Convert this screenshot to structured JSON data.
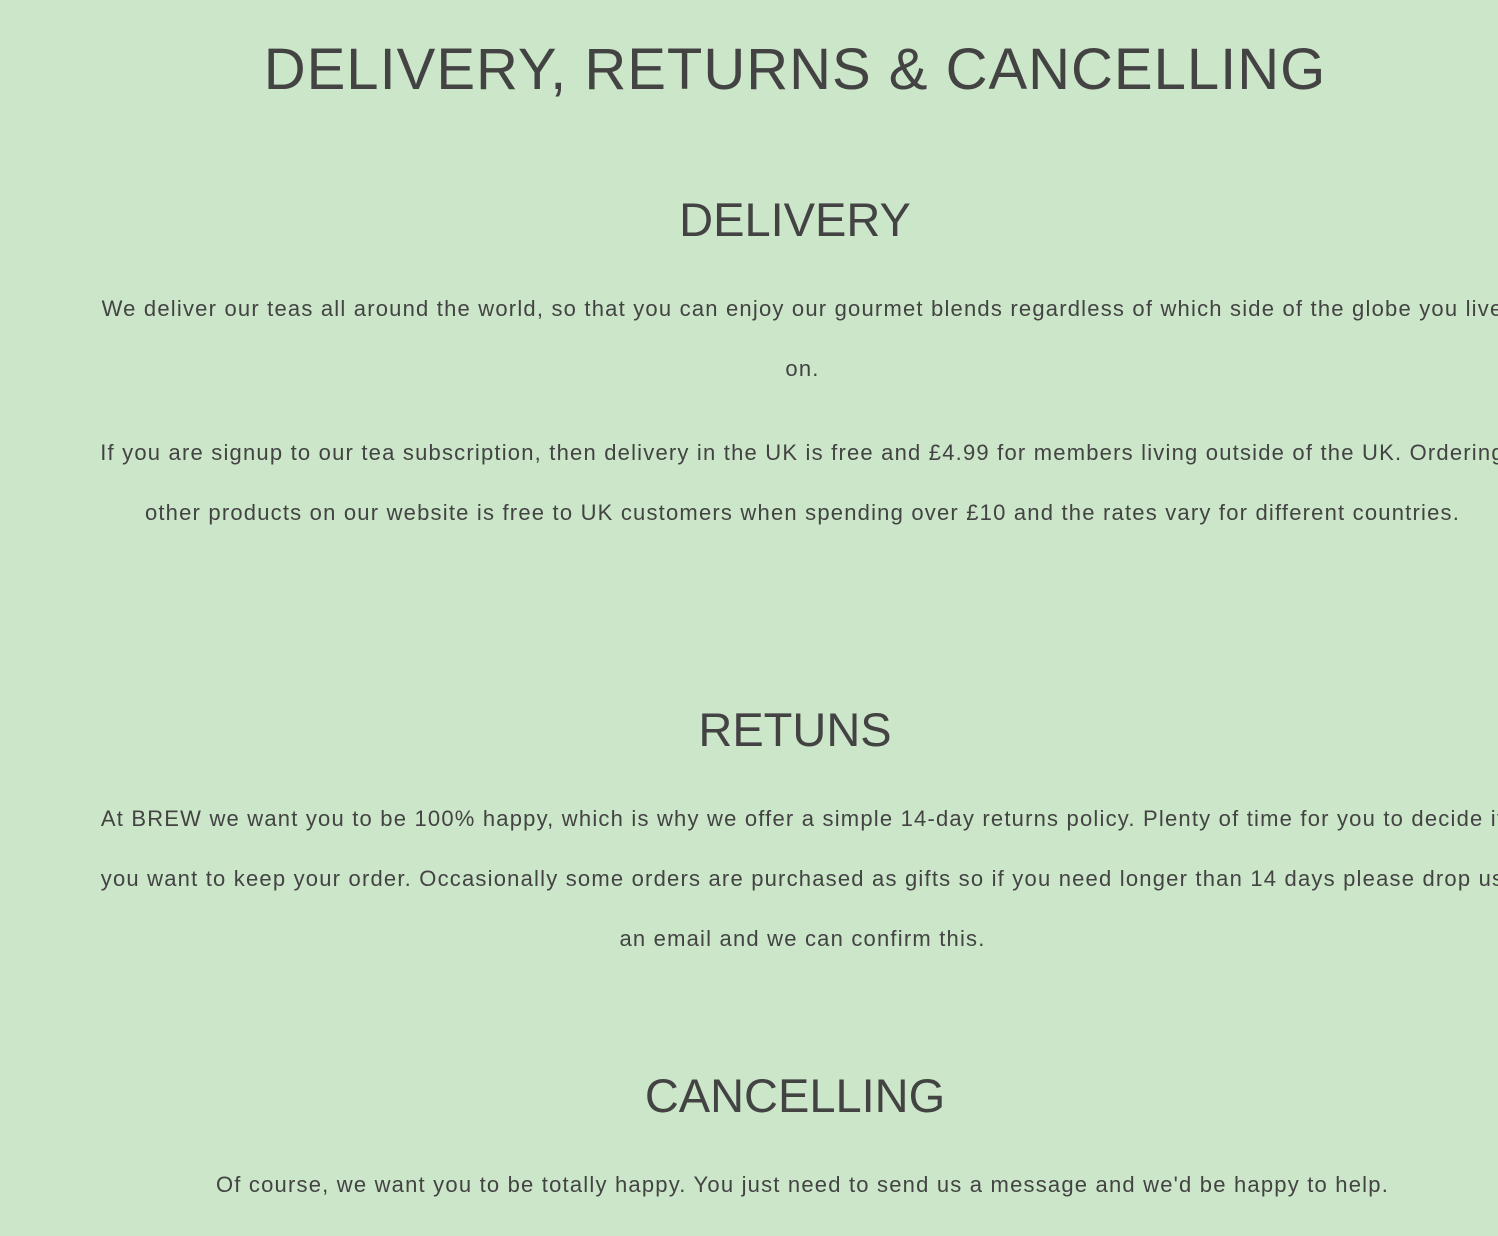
{
  "page": {
    "title": "DELIVERY, RETURNS & CANCELLING",
    "background_color": "#cbe6c8",
    "text_color": "#434343"
  },
  "sections": [
    {
      "heading": "DELIVERY",
      "paragraphs": [
        "We deliver our teas all around the world, so that you can enjoy our gourmet blends regardless of which side of the globe you live on.",
        "If you are signup to our tea subscription, then delivery in the UK is free and £4.99 for members living outside of the UK. Ordering other products on our website is free to UK customers when spending over £10 and the rates vary for different countries."
      ]
    },
    {
      "heading": "RETUNS",
      "paragraphs": [
        "At BREW we want you to be 100% happy, which is why we offer a simple 14-day returns policy. Plenty of time for you to decide if you want to keep your order. Occasionally some orders are purchased as gifts so if you need longer than 14 days please drop us an email and we can confirm this."
      ]
    },
    {
      "heading": "CANCELLING",
      "paragraphs": [
        "Of course, we want you to be totally happy. You just need to send us a message and we'd be happy to help."
      ]
    }
  ]
}
